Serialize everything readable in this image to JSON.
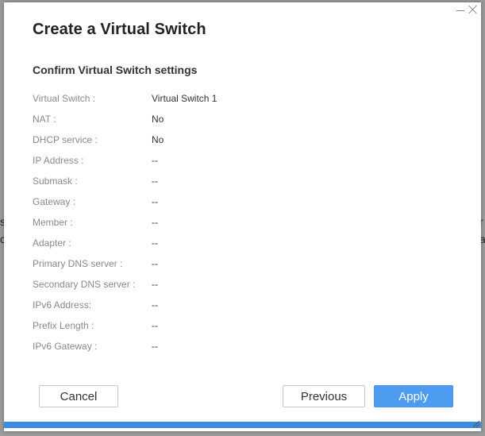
{
  "background": {
    "left_peek": "si\nc",
    "right_peek": "r\na"
  },
  "dialog": {
    "title": "Create a Virtual Switch",
    "subtitle": "Confirm Virtual Switch settings",
    "window_controls": {
      "minimize_icon": "minimize-icon",
      "close_icon": "close-icon"
    },
    "rows": [
      {
        "label": "Virtual Switch :",
        "value": "Virtual Switch 1"
      },
      {
        "label": "NAT :",
        "value": "No"
      },
      {
        "label": "DHCP service :",
        "value": "No"
      },
      {
        "label": "IP Address :",
        "value": "--"
      },
      {
        "label": "Submask :",
        "value": "--"
      },
      {
        "label": "Gateway :",
        "value": "--"
      },
      {
        "label": "Member :",
        "value": "--"
      },
      {
        "label": "Adapter :",
        "value": "--"
      },
      {
        "label": "Primary DNS server :",
        "value": "--"
      },
      {
        "label": "Secondary DNS server :",
        "value": "--"
      },
      {
        "label": "IPv6 Address:",
        "value": "--"
      },
      {
        "label": "Prefix Length :",
        "value": "--"
      },
      {
        "label": "IPv6 Gateway :",
        "value": "--"
      }
    ],
    "buttons": {
      "cancel": "Cancel",
      "previous": "Previous",
      "apply": "Apply"
    },
    "progress": 1.0,
    "colors": {
      "primary": "#4d9cf0",
      "progress": "#3b8de3",
      "label": "#8a8a8a"
    }
  }
}
